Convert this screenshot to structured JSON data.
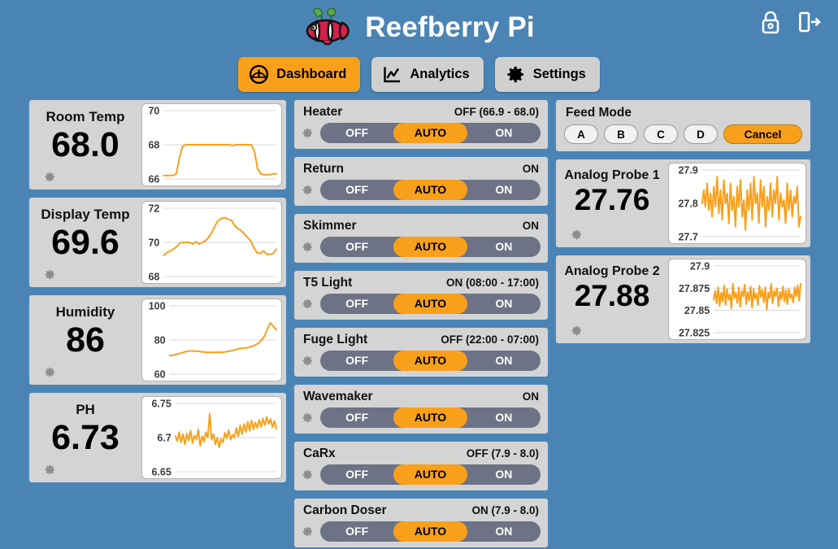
{
  "app": {
    "title": "Reefberry Pi",
    "logo_icon": "clownfish-logo-icon"
  },
  "header": {
    "lock_icon": "lock-icon",
    "logout_icon": "logout-icon"
  },
  "nav": {
    "tabs": [
      {
        "label": "Dashboard",
        "icon": "gauge-icon",
        "active": true
      },
      {
        "label": "Analytics",
        "icon": "line-chart-icon",
        "active": false
      },
      {
        "label": "Settings",
        "icon": "gear-icon",
        "active": false
      }
    ]
  },
  "colors": {
    "background": "#4a84b4",
    "panel": "#d4d4d4",
    "panel_border": "#4a86b8",
    "accent_orange": "#f9a01b",
    "toggle_track": "#6e7285",
    "chart_line": "#f9a01b"
  },
  "sensors": [
    {
      "name": "Room Temp",
      "value": "68.0",
      "gear_icon": "gear-icon",
      "ticks": [
        "70",
        "68",
        "66"
      ]
    },
    {
      "name": "Display Temp",
      "value": "69.6",
      "gear_icon": "gear-icon",
      "ticks": [
        "72",
        "70",
        "68"
      ]
    },
    {
      "name": "Humidity",
      "value": "86",
      "gear_icon": "gear-icon",
      "ticks": [
        "100",
        "80",
        "60"
      ]
    },
    {
      "name": "PH",
      "value": "6.73",
      "gear_icon": "gear-icon",
      "ticks": [
        "6.75",
        "6.7",
        "6.65"
      ]
    }
  ],
  "outlets": [
    {
      "name": "Heater",
      "status": "OFF (66.9 - 68.0)",
      "mode": "AUTO",
      "gear_icon": "gear-icon"
    },
    {
      "name": "Return",
      "status": "ON",
      "mode": "AUTO",
      "gear_icon": "gear-icon"
    },
    {
      "name": "Skimmer",
      "status": "ON",
      "mode": "AUTO",
      "gear_icon": "gear-icon"
    },
    {
      "name": "T5 Light",
      "status": "ON (08:00 - 17:00)",
      "mode": "AUTO",
      "gear_icon": "gear-icon"
    },
    {
      "name": "Fuge Light",
      "status": "OFF (22:00 - 07:00)",
      "mode": "AUTO",
      "gear_icon": "gear-icon"
    },
    {
      "name": "Wavemaker",
      "status": "ON",
      "mode": "AUTO",
      "gear_icon": "gear-icon"
    },
    {
      "name": "CaRx",
      "status": "OFF (7.9 - 8.0)",
      "mode": "AUTO",
      "gear_icon": "gear-icon"
    },
    {
      "name": "Carbon Doser",
      "status": "ON (7.9 - 8.0)",
      "mode": "AUTO",
      "gear_icon": "gear-icon"
    }
  ],
  "outlet_modes": {
    "off": "OFF",
    "auto": "AUTO",
    "on": "ON"
  },
  "feed_mode": {
    "title": "Feed Mode",
    "buttons": [
      "A",
      "B",
      "C",
      "D"
    ],
    "cancel_label": "Cancel"
  },
  "probes": [
    {
      "name": "Analog Probe 1",
      "value": "27.76",
      "gear_icon": "gear-icon",
      "ticks": [
        "27.9",
        "27.8",
        "27.7"
      ]
    },
    {
      "name": "Analog Probe 2",
      "value": "27.88",
      "gear_icon": "gear-icon",
      "ticks": [
        "27.9",
        "27.875",
        "27.85",
        "27.825"
      ]
    }
  ],
  "chart_data": [
    {
      "id": "room-temp",
      "type": "line",
      "title": "Room Temp",
      "ylabel": "",
      "ylim": [
        66,
        70
      ],
      "yticks": [
        66,
        68,
        70
      ],
      "grid": true,
      "series": [
        {
          "name": "Room Temp",
          "values": [
            66.2,
            66.2,
            66.2,
            66.2,
            66.3,
            67.2,
            67.9,
            68.0,
            68.0,
            68.0,
            68.0,
            68.0,
            68.0,
            68.0,
            68.0,
            68.0,
            68.0,
            68.0,
            68.0,
            68.0,
            68.0,
            68.0,
            67.95,
            68.0,
            68.0,
            68.0,
            68.0,
            68.0,
            68.0,
            67.6,
            66.6,
            66.3,
            66.25,
            66.25,
            66.25,
            66.3,
            66.3
          ]
        }
      ]
    },
    {
      "id": "display-temp",
      "type": "line",
      "title": "Display Temp",
      "ylabel": "",
      "ylim": [
        68,
        72
      ],
      "yticks": [
        68,
        70,
        72
      ],
      "grid": true,
      "series": [
        {
          "name": "Display Temp",
          "values": [
            69.25,
            69.4,
            69.5,
            69.6,
            69.75,
            69.95,
            70.0,
            70.0,
            70.0,
            69.9,
            70.05,
            69.9,
            70.0,
            70.1,
            70.3,
            70.6,
            71.0,
            71.3,
            71.4,
            71.45,
            71.35,
            71.3,
            71.0,
            70.8,
            70.7,
            70.5,
            70.3,
            70.1,
            69.7,
            69.4,
            69.35,
            69.5,
            69.3,
            69.3,
            69.35,
            69.6
          ]
        }
      ]
    },
    {
      "id": "humidity",
      "type": "line",
      "title": "Humidity",
      "ylabel": "",
      "ylim": [
        60,
        100
      ],
      "yticks": [
        60,
        80,
        100
      ],
      "grid": true,
      "series": [
        {
          "name": "Humidity",
          "values": [
            71,
            71,
            71.5,
            72,
            72.5,
            73,
            73.5,
            73.5,
            73.5,
            73.5,
            73.2,
            73,
            72.8,
            72.7,
            72.7,
            72.8,
            72.8,
            72.8,
            73,
            73.2,
            73.6,
            74,
            74.5,
            75,
            75.2,
            75.3,
            75.8,
            76.2,
            77,
            78,
            79.5,
            82,
            86,
            90,
            88,
            86
          ]
        }
      ]
    },
    {
      "id": "ph",
      "type": "line",
      "title": "PH",
      "ylabel": "",
      "ylim": [
        6.65,
        6.75
      ],
      "yticks": [
        6.65,
        6.7,
        6.75
      ],
      "grid": true,
      "series": [
        {
          "name": "PH",
          "values": [
            6.702,
            6.695,
            6.708,
            6.693,
            6.705,
            6.69,
            6.706,
            6.696,
            6.71,
            6.692,
            6.703,
            6.697,
            6.712,
            6.688,
            6.702,
            6.694,
            6.708,
            6.7,
            6.735,
            6.697,
            6.705,
            6.69,
            6.7,
            6.686,
            6.698,
            6.693,
            6.707,
            6.699,
            6.711,
            6.697,
            6.704,
            6.7,
            6.714,
            6.702,
            6.718,
            6.705,
            6.72,
            6.708,
            6.723,
            6.71,
            6.725,
            6.712,
            6.722,
            6.714,
            6.726,
            6.716,
            6.728,
            6.718,
            6.73,
            6.72,
            6.727,
            6.715,
            6.724,
            6.713
          ]
        }
      ]
    },
    {
      "id": "analog-probe-1",
      "type": "line",
      "title": "Analog Probe 1",
      "ylabel": "",
      "ylim": [
        27.7,
        27.9
      ],
      "yticks": [
        27.7,
        27.8,
        27.9
      ],
      "grid": true,
      "series": [
        {
          "name": "Analog Probe 1",
          "values": [
            27.8,
            27.84,
            27.79,
            27.86,
            27.78,
            27.83,
            27.76,
            27.85,
            27.79,
            27.88,
            27.77,
            27.84,
            27.75,
            27.87,
            27.8,
            27.83,
            27.74,
            27.86,
            27.78,
            27.82,
            27.73,
            27.85,
            27.79,
            27.87,
            27.76,
            27.81,
            27.72,
            27.84,
            27.78,
            27.86,
            27.75,
            27.88,
            27.8,
            27.83,
            27.74,
            27.87,
            27.79,
            27.85,
            27.73,
            27.82,
            27.78,
            27.86,
            27.76,
            27.84,
            27.8,
            27.88,
            27.75,
            27.83,
            27.79,
            27.81,
            27.74,
            27.86,
            27.78,
            27.84,
            27.76,
            27.82,
            27.8,
            27.85,
            27.73,
            27.76
          ]
        }
      ]
    },
    {
      "id": "analog-probe-2",
      "type": "line",
      "title": "Analog Probe 2",
      "ylabel": "",
      "ylim": [
        27.825,
        27.9
      ],
      "yticks": [
        27.825,
        27.85,
        27.875,
        27.9
      ],
      "grid": true,
      "series": [
        {
          "name": "Analog Probe 2",
          "values": [
            27.862,
            27.872,
            27.858,
            27.876,
            27.855,
            27.87,
            27.86,
            27.878,
            27.856,
            27.874,
            27.862,
            27.868,
            27.852,
            27.88,
            27.864,
            27.87,
            27.858,
            27.876,
            27.854,
            27.872,
            27.866,
            27.879,
            27.857,
            27.871,
            27.861,
            27.877,
            27.853,
            27.874,
            27.863,
            27.869,
            27.856,
            27.878,
            27.865,
            27.873,
            27.859,
            27.876,
            27.851,
            27.87,
            27.864,
            27.88,
            27.858,
            27.872,
            27.866,
            27.875,
            27.855,
            27.871,
            27.862,
            27.877,
            27.86,
            27.873,
            27.857,
            27.874,
            27.864,
            27.868,
            27.859,
            27.876,
            27.866,
            27.878,
            27.861,
            27.88
          ]
        }
      ]
    }
  ]
}
